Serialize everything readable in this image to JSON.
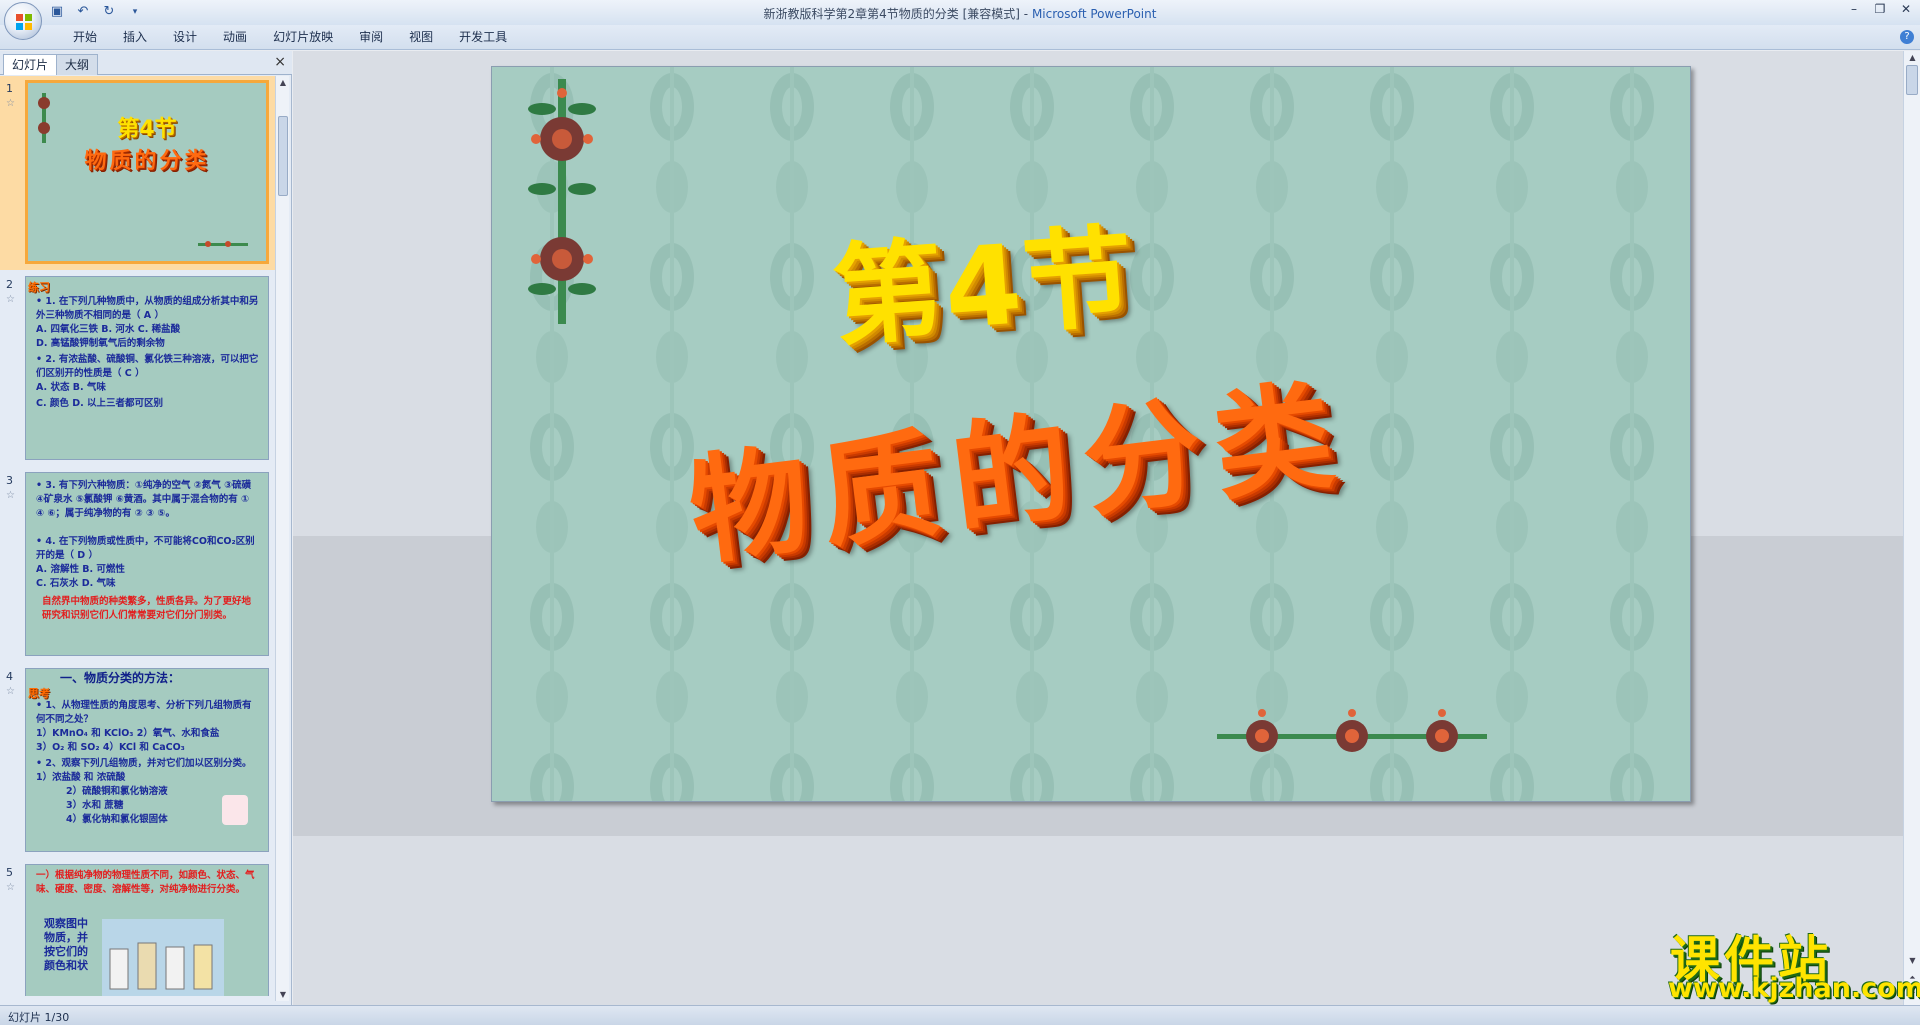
{
  "window": {
    "title": "新浙教版科学第2章第4节物质的分类 [兼容模式]",
    "app_name": "Microsoft PowerPoint",
    "separator": " - "
  },
  "quick_access": {
    "save_icon": "save-icon",
    "undo_icon": "undo-icon",
    "redo_icon": "redo-icon"
  },
  "ribbon": {
    "tabs": [
      "开始",
      "插入",
      "设计",
      "动画",
      "幻灯片放映",
      "审阅",
      "视图",
      "开发工具"
    ]
  },
  "panel": {
    "tabs": [
      "幻灯片",
      "大纲"
    ],
    "close_label": "×"
  },
  "thumbnails": [
    {
      "number": "1",
      "title_line1": "第4节",
      "title_line2": "物质的分类"
    },
    {
      "number": "2",
      "label": "练习",
      "lines": [
        "• 1. 在下列几种物质中，从物质的组成分析其中和另外三种物质不相同的是（ A ）",
        "A. 四氧化三铁    B. 河水    C. 稀盐酸",
        "D. 高锰酸钾制氧气后的剩余物",
        "• 2. 有浓盐酸、硫酸铜、氯化铁三种溶液，可以把它们区别开的性质是（ C ）",
        "A. 状态            B. 气味",
        "C. 颜色            D. 以上三者都可区别"
      ]
    },
    {
      "number": "3",
      "lines": [
        "• 3. 有下列六种物质：①纯净的空气 ②氮气 ③硫磺 ④矿泉水 ⑤氯酸钾 ⑥黄酒。其中属于混合物的有 ① ④ ⑥；属于纯净物的有 ② ③ ⑤。",
        "• 4. 在下列物质或性质中，不可能将CO和CO₂区别开的是（ D ）",
        "A. 溶解性            B. 可燃性",
        "C. 石灰水            D. 气味"
      ],
      "red_text": "自然界中物质的种类繁多，性质各异。为了更好地研究和识别它们人们常常要对它们分门别类。"
    },
    {
      "number": "4",
      "label": "思考",
      "heading": "一、物质分类的方法：",
      "lines": [
        "• 1、从物理性质的角度思考、分析下列几组物质有何不同之处？",
        "1）KMnO₄ 和 KClO₃    2）氧气、水和食盐",
        "3）O₂ 和 SO₂            4）KCl 和 CaCO₃",
        "• 2、观察下列几组物质，并对它们加以区别分类。1）浓盐酸 和 浓硫酸",
        "2）硫酸铜和氯化钠溶液",
        "3）水和 蔗糖",
        "4）氯化钠和氯化银固体"
      ]
    },
    {
      "number": "5",
      "red_text": "一）根据纯净物的物理性质不同，如颜色、状态、气味、硬度、密度、溶解性等，对纯净物进行分类。",
      "side_text": "观察图中物质，并按它们的颜色和状"
    }
  ],
  "slide": {
    "title_line1": "第4节",
    "title_line2": "物质的分类",
    "background_color": "#a6ccc2",
    "title1_color": "#ffe100",
    "title2_color": "#ff6a10"
  },
  "statusbar": {
    "text": "幻灯片 1/30"
  },
  "watermark": {
    "line1": "课件站",
    "line2": "www.kjzhan.com"
  }
}
